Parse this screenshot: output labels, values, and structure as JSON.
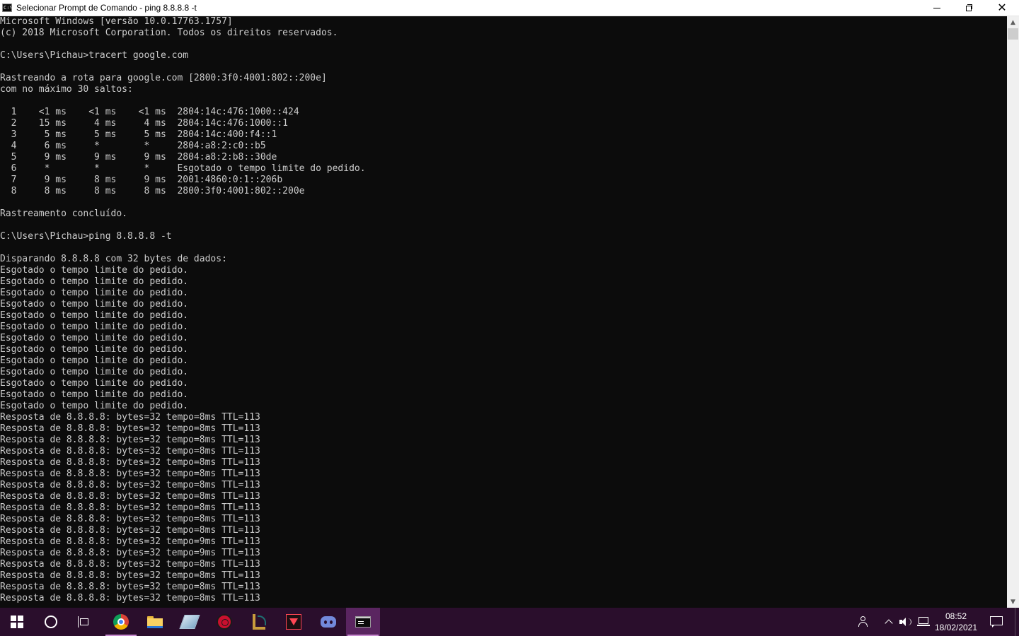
{
  "window": {
    "title": "Selecionar Prompt de Comando - ping  8.8.8.8 -t",
    "icon": "cmd-icon",
    "icon_text": "C:\\"
  },
  "console": {
    "lines": [
      "Microsoft Windows [versão 10.0.17763.1757]",
      "(c) 2018 Microsoft Corporation. Todos os direitos reservados.",
      "",
      "C:\\Users\\Pichau>tracert google.com",
      "",
      "Rastreando a rota para google.com [2800:3f0:4001:802::200e]",
      "com no máximo 30 saltos:",
      "",
      "  1    <1 ms    <1 ms    <1 ms  2804:14c:476:1000::424",
      "  2    15 ms     4 ms     4 ms  2804:14c:476:1000::1",
      "  3     5 ms     5 ms     5 ms  2804:14c:400:f4::1",
      "  4     6 ms     *        *     2804:a8:2:c0::b5",
      "  5     9 ms     9 ms     9 ms  2804:a8:2:b8::30de",
      "  6     *        *        *     Esgotado o tempo limite do pedido.",
      "  7     9 ms     8 ms     9 ms  2001:4860:0:1::206b",
      "  8     8 ms     8 ms     8 ms  2800:3f0:4001:802::200e",
      "",
      "Rastreamento concluído.",
      "",
      "C:\\Users\\Pichau>ping 8.8.8.8 -t",
      "",
      "Disparando 8.8.8.8 com 32 bytes de dados:",
      "Esgotado o tempo limite do pedido.",
      "Esgotado o tempo limite do pedido.",
      "Esgotado o tempo limite do pedido.",
      "Esgotado o tempo limite do pedido.",
      "Esgotado o tempo limite do pedido.",
      "Esgotado o tempo limite do pedido.",
      "Esgotado o tempo limite do pedido.",
      "Esgotado o tempo limite do pedido.",
      "Esgotado o tempo limite do pedido.",
      "Esgotado o tempo limite do pedido.",
      "Esgotado o tempo limite do pedido.",
      "Esgotado o tempo limite do pedido.",
      "Esgotado o tempo limite do pedido.",
      "Resposta de 8.8.8.8: bytes=32 tempo=8ms TTL=113",
      "Resposta de 8.8.8.8: bytes=32 tempo=8ms TTL=113",
      "Resposta de 8.8.8.8: bytes=32 tempo=8ms TTL=113",
      "Resposta de 8.8.8.8: bytes=32 tempo=8ms TTL=113",
      "Resposta de 8.8.8.8: bytes=32 tempo=8ms TTL=113",
      "Resposta de 8.8.8.8: bytes=32 tempo=8ms TTL=113",
      "Resposta de 8.8.8.8: bytes=32 tempo=8ms TTL=113",
      "Resposta de 8.8.8.8: bytes=32 tempo=8ms TTL=113",
      "Resposta de 8.8.8.8: bytes=32 tempo=8ms TTL=113",
      "Resposta de 8.8.8.8: bytes=32 tempo=8ms TTL=113",
      "Resposta de 8.8.8.8: bytes=32 tempo=8ms TTL=113",
      "Resposta de 8.8.8.8: bytes=32 tempo=9ms TTL=113",
      "Resposta de 8.8.8.8: bytes=32 tempo=9ms TTL=113",
      "Resposta de 8.8.8.8: bytes=32 tempo=8ms TTL=113",
      "Resposta de 8.8.8.8: bytes=32 tempo=8ms TTL=113",
      "Resposta de 8.8.8.8: bytes=32 tempo=8ms TTL=113",
      "Resposta de 8.8.8.8: bytes=32 tempo=8ms TTL=113"
    ]
  },
  "scrollbar": {
    "thumb_position": 0.0,
    "thumb_fraction": 0.02
  },
  "taskbar": {
    "items": [
      {
        "name": "start",
        "icon": "windows-logo-icon",
        "active": false,
        "running": false
      },
      {
        "name": "search",
        "icon": "search-icon",
        "active": false,
        "running": false
      },
      {
        "name": "task-view",
        "icon": "task-view-icon",
        "active": false,
        "running": false
      },
      {
        "name": "chrome",
        "icon": "chrome-icon",
        "active": false,
        "running": true
      },
      {
        "name": "file-explorer",
        "icon": "folder-icon",
        "active": false,
        "running": false
      },
      {
        "name": "eraser-app",
        "icon": "eraser-icon",
        "active": false,
        "running": false
      },
      {
        "name": "red-app",
        "icon": "red-circle-app-icon",
        "active": false,
        "running": false
      },
      {
        "name": "league-of-legends",
        "icon": "league-of-legends-icon",
        "active": false,
        "running": false
      },
      {
        "name": "valorant",
        "icon": "valorant-icon",
        "active": false,
        "running": false
      },
      {
        "name": "discord",
        "icon": "discord-icon",
        "active": false,
        "running": false
      },
      {
        "name": "command-prompt",
        "icon": "cmd-icon",
        "active": true,
        "running": true
      }
    ],
    "tray": {
      "icons": [
        "people-icon",
        "chevron-up-icon",
        "volume-icon",
        "network-icon"
      ],
      "time": "08:52",
      "date": "18/02/2021",
      "notification_icon": "notification-icon"
    }
  },
  "colors": {
    "console_bg": "#0c0c0c",
    "console_fg": "#cccccc",
    "taskbar_bg": "#2a0e2c",
    "taskbar_active": "#5a2560"
  }
}
